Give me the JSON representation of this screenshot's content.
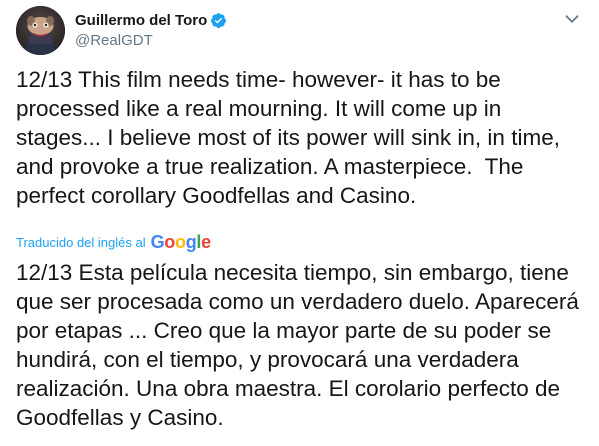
{
  "author": {
    "display_name": "Guillermo del Toro",
    "handle": "@RealGDT",
    "verified": true
  },
  "icons": {
    "verified": "verified-badge-icon",
    "more": "chevron-down-icon"
  },
  "tweet": {
    "text": "12/13 This film needs time- however- it has to be processed like a real mourning. It will come up in stages... I believe most of its power will sink in, in time, and provoke a true realization. A masterpiece.  The perfect corollary Goodfellas and Casino."
  },
  "translation": {
    "label": "Traducido del inglés al",
    "provider": "Google",
    "text": "12/13 Esta película necesita tiempo, sin embargo, tiene que ser procesada como un verdadero duelo. Aparecerá por etapas ... Creo que la mayor parte de su poder se hundirá, con el tiempo, y provocará una verdadera realización. Una obra maestra. El corolario perfecto de Goodfellas y Casino."
  },
  "colors": {
    "verified_blue": "#1da1f2",
    "link_blue": "#1da1f2",
    "secondary_text": "#657786",
    "primary_text": "#14171a",
    "google_blue": "#4285f4",
    "google_red": "#ea4335",
    "google_yellow": "#fbbc05",
    "google_green": "#34a853"
  }
}
